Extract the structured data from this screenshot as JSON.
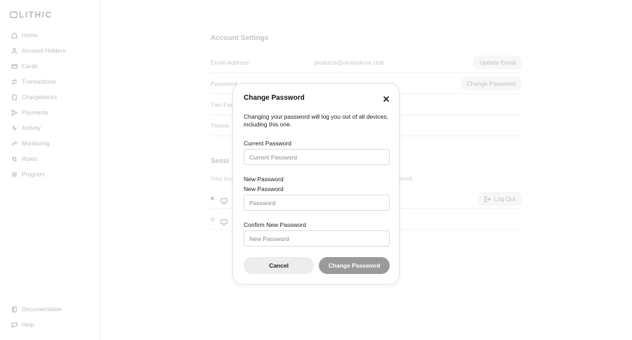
{
  "brand": {
    "logo_text": "LITHIC"
  },
  "sidebar": {
    "items": [
      {
        "label": "Home",
        "icon": "home-icon"
      },
      {
        "label": "Account Holders",
        "icon": "user-icon"
      },
      {
        "label": "Cards",
        "icon": "card-icon"
      },
      {
        "label": "Transactions",
        "icon": "transactions-icon"
      },
      {
        "label": "Chargebacks",
        "icon": "chargebacks-icon"
      },
      {
        "label": "Payments",
        "icon": "payments-icon"
      },
      {
        "label": "Activity",
        "icon": "activity-icon"
      },
      {
        "label": "Monitoring",
        "icon": "monitoring-icon"
      },
      {
        "label": "Rules",
        "icon": "rules-icon"
      },
      {
        "label": "Program",
        "icon": "gear-icon"
      }
    ],
    "footer": [
      {
        "label": "Documentation",
        "icon": "book-icon"
      },
      {
        "label": "Help",
        "icon": "chat-icon"
      }
    ]
  },
  "account_settings": {
    "title": "Account Settings",
    "email_label": "Email Address",
    "email_value": "products@nicelydone.club",
    "update_email": "Update Email",
    "password_label": "Password",
    "change_password": "Change Password",
    "two_factor_label": "Two-Fac",
    "theme_label": "Theme"
  },
  "sessions": {
    "title": "Sessi",
    "text_left": "Your bro",
    "text_right": "t week.",
    "log_out": "Log Out"
  },
  "modal": {
    "title": "Change Password",
    "description": "Changing your password will log you out of all devices, including this one.",
    "current_label": "Current Password",
    "current_placeholder": "Current Password",
    "new_label_1": "New Password",
    "new_label_2": "New Password",
    "new_placeholder": "Password",
    "confirm_label": "Confirm New Password",
    "confirm_placeholder": "New Password",
    "cancel": "Cancel",
    "submit": "Change Password"
  },
  "colors": {
    "submit_bg": "#9a9a9a",
    "cancel_bg": "#ededed"
  }
}
